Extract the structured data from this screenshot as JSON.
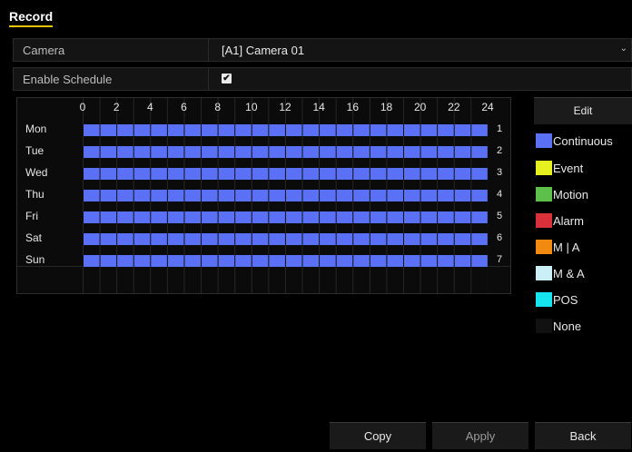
{
  "tab": {
    "label": "Record"
  },
  "camera": {
    "label": "Camera",
    "value": "[A1] Camera 01"
  },
  "enable_schedule": {
    "label": "Enable Schedule",
    "checked": true
  },
  "schedule": {
    "hours": [
      "0",
      "2",
      "4",
      "6",
      "8",
      "10",
      "12",
      "14",
      "16",
      "18",
      "20",
      "22",
      "24"
    ],
    "days": [
      {
        "label": "Mon",
        "num": "1",
        "type": "Continuous"
      },
      {
        "label": "Tue",
        "num": "2",
        "type": "Continuous"
      },
      {
        "label": "Wed",
        "num": "3",
        "type": "Continuous"
      },
      {
        "label": "Thu",
        "num": "4",
        "type": "Continuous"
      },
      {
        "label": "Fri",
        "num": "5",
        "type": "Continuous"
      },
      {
        "label": "Sat",
        "num": "6",
        "type": "Continuous"
      },
      {
        "label": "Sun",
        "num": "7",
        "type": "Continuous"
      }
    ],
    "bar_color": "#5a71f5"
  },
  "edit_label": "Edit",
  "legend": [
    {
      "label": "Continuous",
      "color": "#5a71f5"
    },
    {
      "label": "Event",
      "color": "#e6ef1f"
    },
    {
      "label": "Motion",
      "color": "#5cc04a"
    },
    {
      "label": "Alarm",
      "color": "#d9303a"
    },
    {
      "label": "M | A",
      "color": "#f28a12"
    },
    {
      "label": "M & A",
      "color": "#cbeff6"
    },
    {
      "label": "POS",
      "color": "#16e4ee"
    },
    {
      "label": "None",
      "color": "#111111"
    }
  ],
  "footer": {
    "copy": "Copy",
    "apply": "Apply",
    "back": "Back"
  }
}
